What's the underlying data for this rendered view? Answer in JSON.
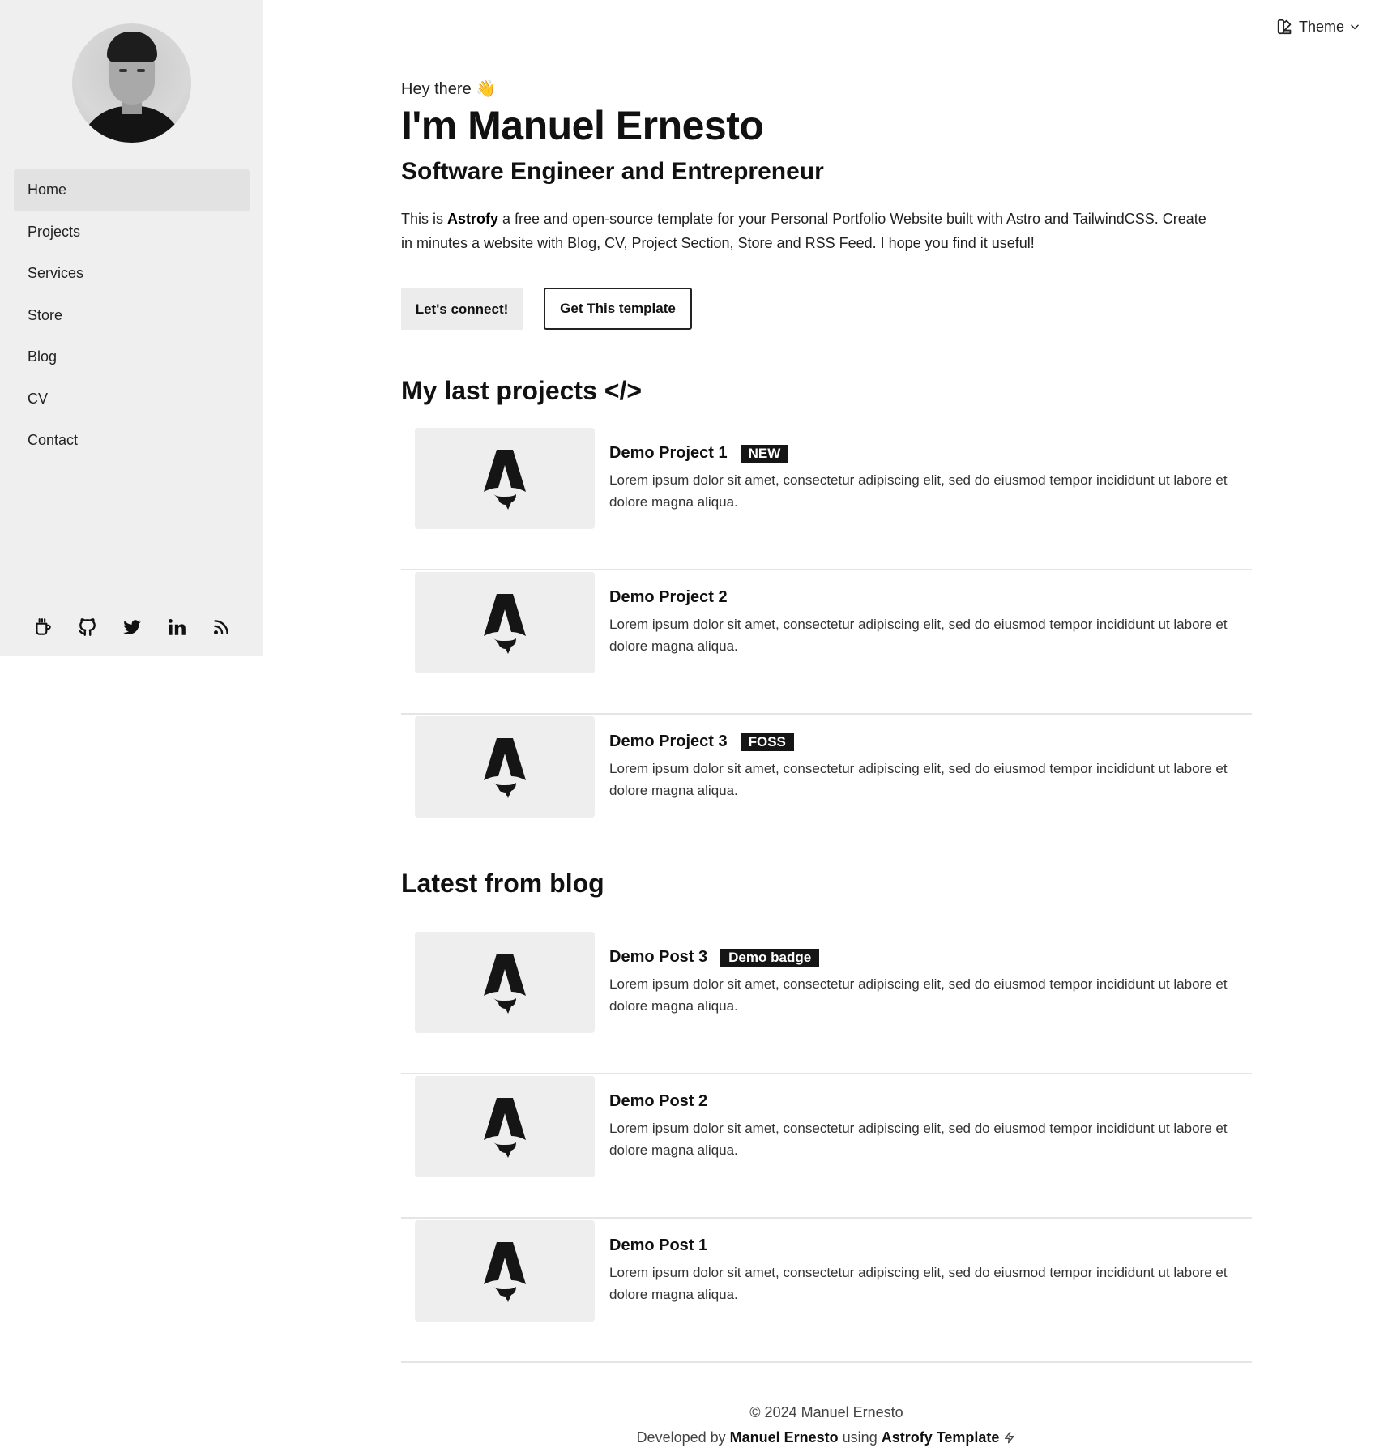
{
  "sidebar": {
    "nav": [
      {
        "label": "Home",
        "active": true
      },
      {
        "label": "Projects"
      },
      {
        "label": "Services"
      },
      {
        "label": "Store"
      },
      {
        "label": "Blog"
      },
      {
        "label": "CV"
      },
      {
        "label": "Contact"
      }
    ],
    "social": [
      "coffee-icon",
      "github-icon",
      "twitter-icon",
      "linkedin-icon",
      "rss-icon"
    ]
  },
  "header": {
    "theme_label": "Theme"
  },
  "hero": {
    "greeting": "Hey there 👋",
    "name": "I'm Manuel Ernesto",
    "role": "Software Engineer and Entrepreneur",
    "intro_prefix": "This is ",
    "intro_brand": "Astrofy",
    "intro_suffix": " a free and open-source template for your Personal Portfolio Website built with Astro and TailwindCSS. Create in minutes a website with Blog, CV, Project Section, Store and RSS Feed. I hope you find it useful!",
    "connect_button": "Let's connect!",
    "template_button": "Get This template"
  },
  "projects": {
    "title": "My last projects </>",
    "items": [
      {
        "title": "Demo Project 1",
        "badge": "NEW",
        "desc": "Lorem ipsum dolor sit amet, consectetur adipiscing elit, sed do eiusmod tempor incididunt ut labore et dolore magna aliqua."
      },
      {
        "title": "Demo Project 2",
        "badge": "",
        "desc": "Lorem ipsum dolor sit amet, consectetur adipiscing elit, sed do eiusmod tempor incididunt ut labore et dolore magna aliqua."
      },
      {
        "title": "Demo Project 3",
        "badge": "FOSS",
        "desc": "Lorem ipsum dolor sit amet, consectetur adipiscing elit, sed do eiusmod tempor incididunt ut labore et dolore magna aliqua."
      }
    ]
  },
  "blog": {
    "title": "Latest from blog",
    "items": [
      {
        "title": "Demo Post 3",
        "badge": "Demo badge",
        "desc": "Lorem ipsum dolor sit amet, consectetur adipiscing elit, sed do eiusmod tempor incididunt ut labore et dolore magna aliqua."
      },
      {
        "title": "Demo Post 2",
        "badge": "",
        "desc": "Lorem ipsum dolor sit amet, consectetur adipiscing elit, sed do eiusmod tempor incididunt ut labore et dolore magna aliqua."
      },
      {
        "title": "Demo Post 1",
        "badge": "",
        "desc": "Lorem ipsum dolor sit amet, consectetur adipiscing elit, sed do eiusmod tempor incididunt ut labore et dolore magna aliqua."
      }
    ]
  },
  "footer": {
    "copyright": "© 2024 Manuel Ernesto",
    "dev_prefix": "Developed by ",
    "dev_name": "Manuel Ernesto",
    "dev_using": " using ",
    "dev_template": "Astrofy Template"
  }
}
